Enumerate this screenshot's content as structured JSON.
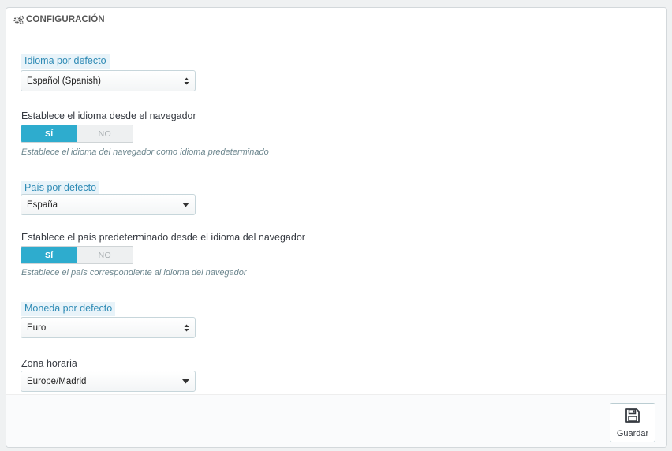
{
  "panel": {
    "title": "CONFIGURACIÓN"
  },
  "fields": {
    "default_language": {
      "label": "Idioma por defecto",
      "value": "Español (Spanish)"
    },
    "browser_language": {
      "label": "Establece el idioma desde el navegador",
      "on_label": "SÍ",
      "off_label": "NO",
      "selected": "SÍ",
      "help": "Establece el idioma del navegador como idioma predeterminado"
    },
    "default_country": {
      "label": "País por defecto",
      "value": "España"
    },
    "browser_country": {
      "label": "Establece el país predeterminado desde el idioma del navegador",
      "on_label": "SÍ",
      "off_label": "NO",
      "selected": "SÍ",
      "help": "Establece el país correspondiente al idioma del navegador"
    },
    "default_currency": {
      "label": "Moneda por defecto",
      "value": "Euro"
    },
    "timezone": {
      "label": "Zona horaria",
      "value": "Europe/Madrid"
    }
  },
  "footer": {
    "save_label": "Guardar"
  },
  "icons": {
    "heading": "cogs-icon",
    "select_updown": "updown-caret-icon",
    "select_dropdown": "caret-down-icon",
    "save": "floppy-disk-icon"
  },
  "colors": {
    "accent": "#2eacce",
    "hint_text": "#2f8bb5",
    "hint_bg": "#e8f3f9"
  }
}
